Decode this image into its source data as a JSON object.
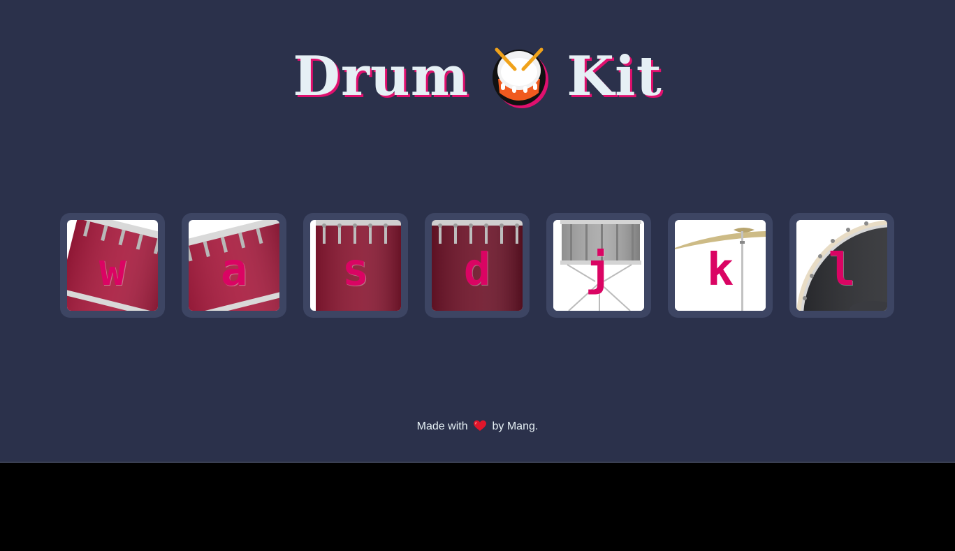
{
  "header": {
    "title_left": "Drum",
    "title_right": "Kit",
    "emoji_icon": "drum-icon"
  },
  "drums": [
    {
      "key": "w",
      "art": "tom-tilted-left-icon",
      "color": "#9e1a3a"
    },
    {
      "key": "a",
      "art": "tom-tilted-right-icon",
      "color": "#9e1a3a"
    },
    {
      "key": "s",
      "art": "floor-tom-icon",
      "color": "#7d1530"
    },
    {
      "key": "d",
      "art": "floor-tom-dark-icon",
      "color": "#6a1228"
    },
    {
      "key": "j",
      "art": "snare-drum-icon",
      "color": "#a8a8a8"
    },
    {
      "key": "k",
      "art": "cymbal-icon",
      "color": "#c9b98a"
    },
    {
      "key": "l",
      "art": "bass-drum-icon",
      "color": "#2e2f33"
    }
  ],
  "footer": {
    "made_with": "Made with",
    "by_author": "by Mang.",
    "heart_icon": "heart-icon"
  },
  "colors": {
    "background": "#2b314b",
    "button_frame": "#3d4563",
    "accent": "#da0463",
    "title_text": "#e6f0f5"
  }
}
